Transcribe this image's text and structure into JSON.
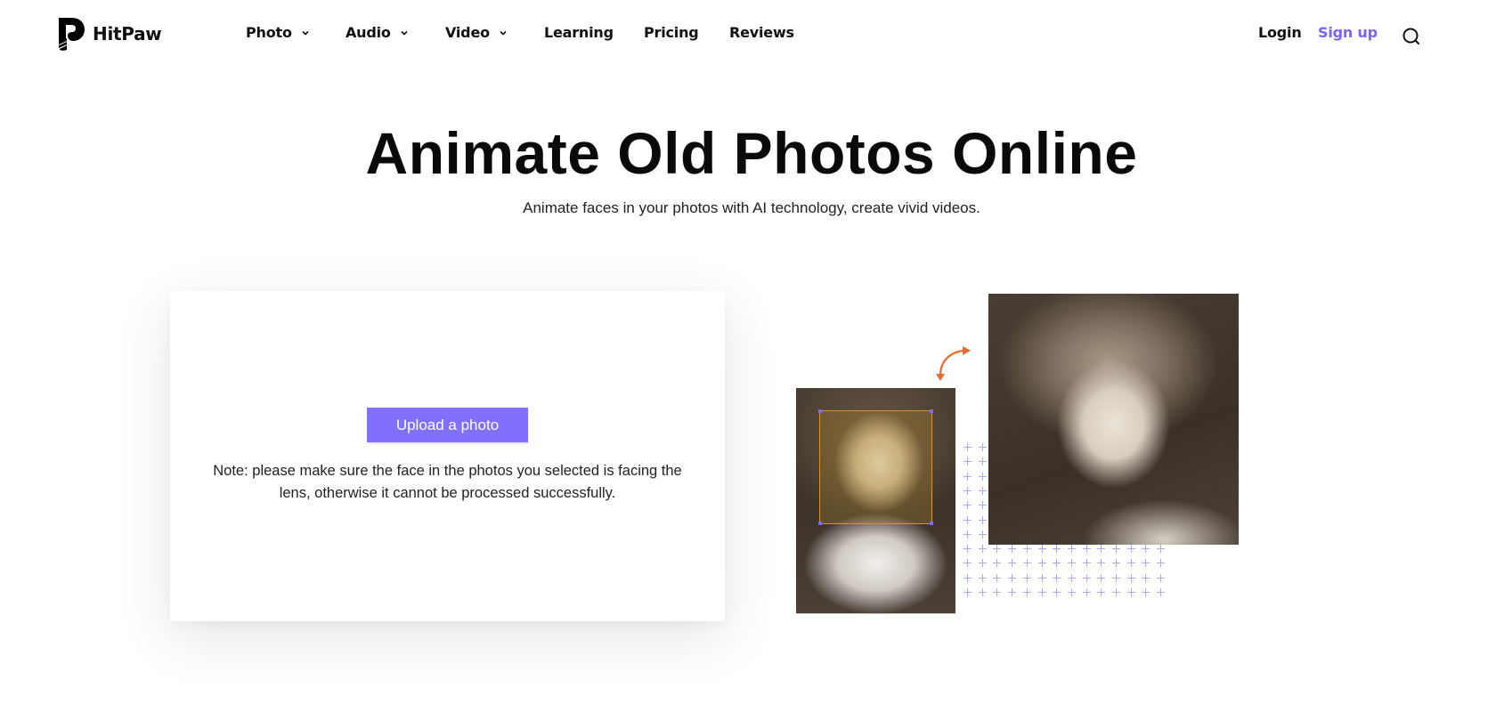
{
  "brand": {
    "name": "HitPaw",
    "logo_icon": "hitpaw-paw-logo-icon"
  },
  "nav": {
    "items": [
      {
        "label": "Photo",
        "has_dropdown": true
      },
      {
        "label": "Audio",
        "has_dropdown": true
      },
      {
        "label": "Video",
        "has_dropdown": true
      },
      {
        "label": "Learning",
        "has_dropdown": false
      },
      {
        "label": "Pricing",
        "has_dropdown": false
      },
      {
        "label": "Reviews",
        "has_dropdown": false
      }
    ],
    "login_label": "Login",
    "signup_label": "Sign up",
    "search_icon": "search-icon"
  },
  "hero": {
    "title": "Animate Old Photos Online",
    "subtitle": "Animate faces in your photos with AI technology, create vivid videos."
  },
  "upload": {
    "button_label": "Upload a photo",
    "note": "Note: please make sure the face in the photos you selected is facing the lens, otherwise it cannot be processed successfully."
  },
  "illustration": {
    "before_image": "vintage sepia portrait of a girl with face detection box",
    "after_image": "animated close-up portrait of the girl",
    "arrow_icon": "swap-arrow-icon"
  },
  "colors": {
    "accent": "#8170fd",
    "signup": "#7b61ff",
    "arrow": "#ee6a2c",
    "face_box": "#d3952a",
    "grid_plus": "#b0a6f7"
  }
}
